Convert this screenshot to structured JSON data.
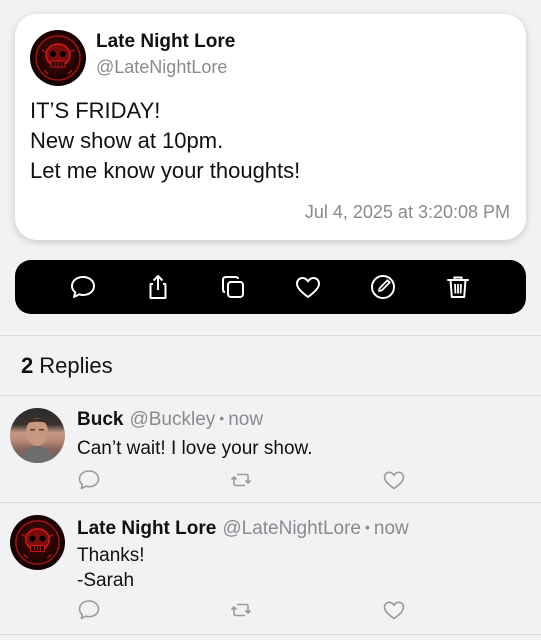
{
  "post": {
    "author": "Late Night Lore",
    "handle": "@LateNightLore",
    "body_lines": [
      "IT’S FRIDAY!",
      "New show at 10pm.",
      "Let me know your thoughts!"
    ],
    "timestamp": "Jul 4, 2025 at 3:20:08 PM"
  },
  "action_bar": {
    "icons": [
      "comment-icon",
      "share-icon",
      "copy-icon",
      "heart-icon",
      "edit-icon",
      "trash-icon"
    ]
  },
  "replies_header": {
    "count": "2",
    "label": "Replies"
  },
  "replies": [
    {
      "name": "Buck",
      "handle": "@Buckley",
      "separator": "•",
      "time": "now",
      "text_lines": [
        "Can’t wait! I love your show."
      ]
    },
    {
      "name": "Late Night Lore",
      "handle": "@LateNightLore",
      "separator": "•",
      "time": "now",
      "text_lines": [
        "Thanks!",
        "-Sarah"
      ]
    }
  ],
  "colors": {
    "secondary_text": "#8a8a8e",
    "action_bar_bg": "#000000",
    "card_bg": "#ffffff"
  }
}
